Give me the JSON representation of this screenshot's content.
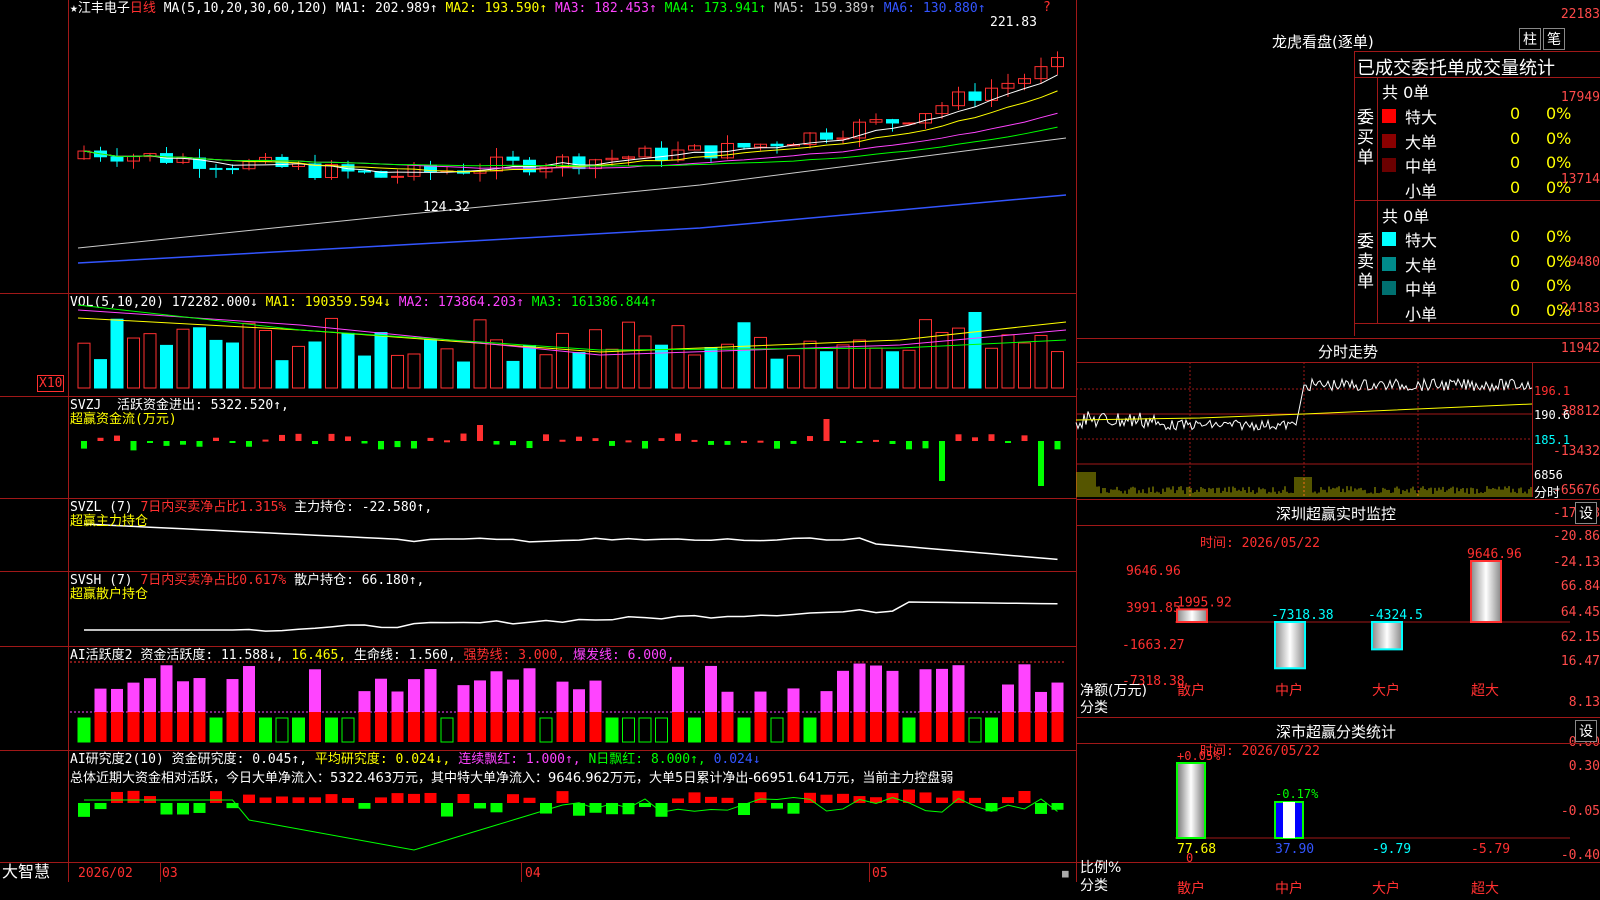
{
  "stock": {
    "star": "★",
    "name": "江丰电子",
    "period": "日线"
  },
  "kline": {
    "ma_label": "MA(5,10,20,30,60,120)",
    "ma_values": [
      {
        "label": "MA1: 202.989↑",
        "color": "#ffffff"
      },
      {
        "label": "MA2: 193.590↑",
        "color": "#ffff00"
      },
      {
        "label": "MA3: 182.453↑",
        "color": "#ff44ff"
      },
      {
        "label": "MA4: 173.941↑",
        "color": "#00ff00"
      },
      {
        "label": "MA5: 159.389↑",
        "color": "#cccccc"
      },
      {
        "label": "MA6: 130.880↑",
        "color": "#3355ff"
      }
    ],
    "axis": [
      "22183",
      "17949",
      "13714",
      "9480"
    ],
    "high_label": "221.83",
    "low_label": "124.32"
  },
  "vol": {
    "header": "VOL(5,10,20)",
    "value": "172282.000↓",
    "ma": [
      {
        "label": "MA1: 190359.594↓",
        "color": "#ffff00"
      },
      {
        "label": "MA2: 173864.203↑",
        "color": "#ff44ff"
      },
      {
        "label": "MA3: 161386.844↑",
        "color": "#00ff00"
      }
    ],
    "axis": [
      "24183",
      "11942"
    ],
    "unit": "X10"
  },
  "svzj": {
    "title": "SVZJ",
    "label": "活跃资金进出: 5322.520↑,",
    "sub": "超赢资金流(万元)",
    "axis": [
      "38812",
      "-13432",
      "-65676"
    ]
  },
  "svzl": {
    "title": "SVZL (7)",
    "red": "7日内买卖净占比1.315%",
    "label": "主力持仓: -22.580↑,",
    "sub": "超赢主力持仓",
    "axis": [
      "-17.58",
      "-20.86",
      "-24.13"
    ]
  },
  "svsh": {
    "title": "SVSH (7)",
    "red": "7日内买卖净占比0.617%",
    "label": "散户持仓: 66.180↑,",
    "sub": "超赢散户持仓",
    "axis": [
      "66.84",
      "64.45",
      "62.15"
    ]
  },
  "ai1": {
    "title": "AI活跃度2",
    "a": "资金活跃度: 11.588↓,",
    "b": "16.465,",
    "c": "生命线: 1.560,",
    "d": "强势线: 3.000,",
    "e": "爆发线: 6.000,",
    "axis": [
      "16.47",
      "8.13",
      "0.00"
    ]
  },
  "ai2": {
    "title": "AI研究度2(10)",
    "a": "资金研究度: 0.045↑,",
    "b": "平均研究度: 0.024↓,",
    "c": "连续飘红: 1.000↑,",
    "d": "N日飘红: 8.000↑,",
    "e": "0.024↓",
    "summary": "总体近期大资金相对活跃，今日大单净流入：5322.463万元，其中特大单净流入：9646.962万元，大单5日累计净出-66951.641万元，当前主力控盘弱",
    "axis": [
      "0.30",
      "-0.05",
      "-0.40"
    ]
  },
  "bottom": {
    "brand": "大智慧",
    "dates": [
      "2026/02",
      "03",
      "04",
      "05"
    ]
  },
  "longhu": {
    "title": "龙虎看盘(逐单)",
    "btn1": "柱",
    "btn2": "笔",
    "tabs_text": "已成交委托单成交量统计",
    "buy": {
      "side": "委买单",
      "total": "共 0单",
      "rows": [
        {
          "label": "特大",
          "v": "0",
          "p": "0%",
          "color": "#ff0000"
        },
        {
          "label": "大单",
          "v": "0",
          "p": "0%",
          "color": "#8b0000"
        },
        {
          "label": "中单",
          "v": "0",
          "p": "0%",
          "color": "#6b0000"
        },
        {
          "label": "小单",
          "v": "0",
          "p": "0%",
          "color": ""
        }
      ]
    },
    "sell": {
      "side": "委卖单",
      "total": "共 0单",
      "rows": [
        {
          "label": "特大",
          "v": "0",
          "p": "0%",
          "color": "#00ffff"
        },
        {
          "label": "大单",
          "v": "0",
          "p": "0%",
          "color": "#008b8b"
        },
        {
          "label": "中单",
          "v": "0",
          "p": "0%",
          "color": "#007070"
        },
        {
          "label": "小单",
          "v": "0",
          "p": "0%",
          "color": ""
        }
      ]
    }
  },
  "intraday": {
    "title": "分时走势",
    "axis": [
      "196.1",
      "190.6",
      "185.1",
      "6856"
    ],
    "unit": "分时"
  },
  "sz_monitor": {
    "title": "深圳超赢实时监控",
    "btn": "设",
    "time": "时间: 2026/05/22",
    "axis": [
      "9646.96",
      "3991.85",
      "-1663.27",
      "-7318.38"
    ],
    "ylabel": "净额(万元)",
    "xlabel": "分类",
    "cats": [
      "散户",
      "中户",
      "大户",
      "超大"
    ],
    "values": [
      1995.92,
      -7318.38,
      -4324.5,
      9646.96
    ],
    "value_labels": [
      "1995.92",
      "-7318.38",
      "-4324.5",
      "9646.96"
    ]
  },
  "sz_class": {
    "title": "深市超赢分类统计",
    "btn": "设",
    "time": "时间: 2026/05/22",
    "axis": [
      "75",
      "50",
      "25",
      "0"
    ],
    "ylabel": "比例%",
    "xlabel": "分类",
    "cats": [
      "散户",
      "中户",
      "大户",
      "超大"
    ],
    "top_labels": [
      "+0.05%",
      "-0.17%"
    ],
    "bottom_labels": [
      "77.68",
      "37.90",
      "-9.79",
      "-5.79"
    ]
  }
}
